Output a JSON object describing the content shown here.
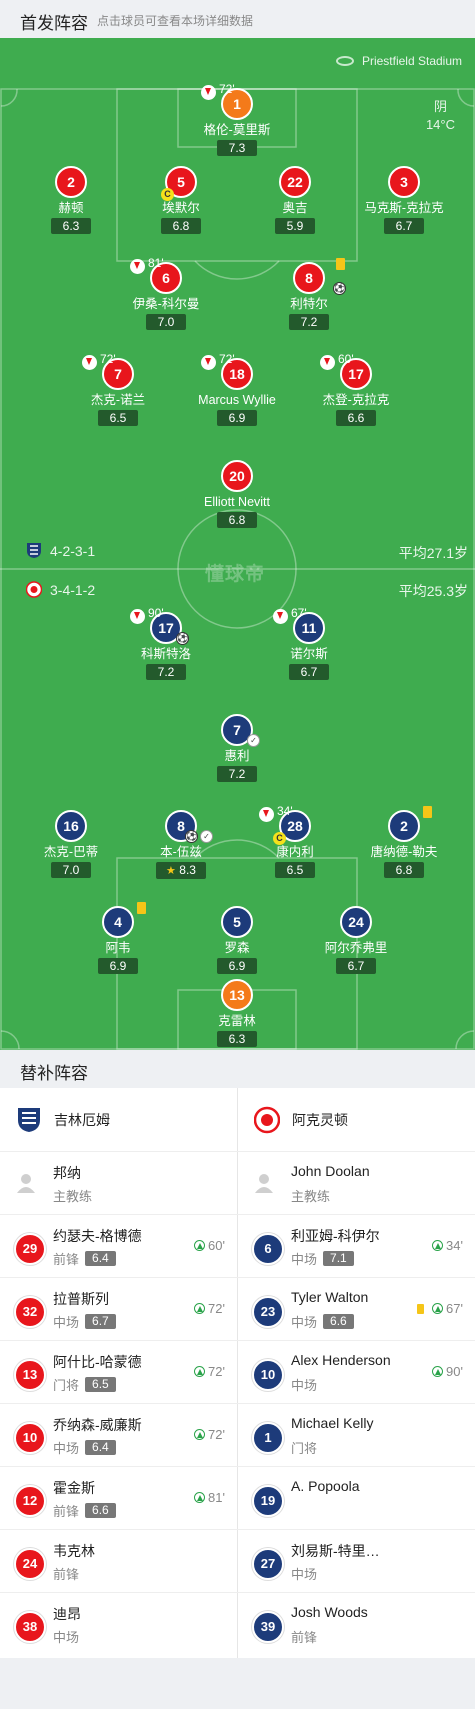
{
  "header": {
    "title": "首发阵容",
    "subtitle": "点击球员可查看本场详细数据"
  },
  "pitch": {
    "stadium": "Priestfield Stadium",
    "weather": {
      "condition": "阴",
      "temp": "14°C"
    },
    "watermark": "懂球帝",
    "home": {
      "formation": "4-2-3-1",
      "avg_age": "平均27.1岁"
    },
    "away": {
      "formation": "3-4-1-2",
      "avg_age": "平均25.3岁"
    }
  },
  "home_players": [
    {
      "num": "1",
      "name": "格伦-莫里斯",
      "rating": "7.3",
      "sub_min": "72'"
    },
    {
      "num": "2",
      "name": "赫顿",
      "rating": "6.3"
    },
    {
      "num": "5",
      "name": "埃默尔",
      "rating": "6.8"
    },
    {
      "num": "22",
      "name": "奥吉",
      "rating": "5.9"
    },
    {
      "num": "3",
      "name": "马克斯-克拉克",
      "rating": "6.7"
    },
    {
      "num": "6",
      "name": "伊桑-科尔曼",
      "rating": "7.0",
      "sub_min": "81'"
    },
    {
      "num": "8",
      "name": "利特尔",
      "rating": "7.2"
    },
    {
      "num": "7",
      "name": "杰克-诺兰",
      "rating": "6.5",
      "sub_min": "72'"
    },
    {
      "num": "18",
      "name": "Marcus Wyllie",
      "rating": "6.9",
      "sub_min": "72'"
    },
    {
      "num": "17",
      "name": "杰登-克拉克",
      "rating": "6.6",
      "sub_min": "60'"
    },
    {
      "num": "20",
      "name": "Elliott Nevitt",
      "rating": "6.8"
    }
  ],
  "away_players": [
    {
      "num": "17",
      "name": "科斯特洛",
      "rating": "7.2",
      "sub_min": "90'"
    },
    {
      "num": "11",
      "name": "诺尔斯",
      "rating": "6.7",
      "sub_min": "67'"
    },
    {
      "num": "7",
      "name": "惠利",
      "rating": "7.2"
    },
    {
      "num": "16",
      "name": "杰克-巴蒂",
      "rating": "7.0"
    },
    {
      "num": "8",
      "name": "本-伍兹",
      "rating": "8.3"
    },
    {
      "num": "28",
      "name": "康内利",
      "rating": "6.5",
      "sub_min": "34'"
    },
    {
      "num": "2",
      "name": "唐纳德-勒夫",
      "rating": "6.8"
    },
    {
      "num": "4",
      "name": "阿韦",
      "rating": "6.9"
    },
    {
      "num": "5",
      "name": "罗森",
      "rating": "6.9"
    },
    {
      "num": "24",
      "name": "阿尔乔弗里",
      "rating": "6.7"
    },
    {
      "num": "13",
      "name": "克雷林",
      "rating": "6.3"
    }
  ],
  "subs_header": {
    "title": "替补阵容"
  },
  "subs": {
    "home_team": "吉林厄姆",
    "away_team": "阿克灵顿",
    "home_coach": {
      "name": "邦纳",
      "role": "主教练"
    },
    "away_coach": {
      "name": "John Doolan",
      "role": "主教练"
    },
    "home": [
      {
        "num": "29",
        "name": "约瑟夫-格博德",
        "pos": "前锋",
        "rating": "6.4",
        "in": "60'"
      },
      {
        "num": "32",
        "name": "拉普斯列",
        "pos": "中场",
        "rating": "6.7",
        "in": "72'"
      },
      {
        "num": "13",
        "name": "阿什比-哈蒙德",
        "pos": "门将",
        "rating": "6.5",
        "in": "72'"
      },
      {
        "num": "10",
        "name": "乔纳森-威廉斯",
        "pos": "中场",
        "rating": "6.4",
        "in": "72'"
      },
      {
        "num": "12",
        "name": "霍金斯",
        "pos": "前锋",
        "rating": "6.6",
        "in": "81'"
      },
      {
        "num": "24",
        "name": "韦克林",
        "pos": "前锋"
      },
      {
        "num": "38",
        "name": "迪昂",
        "pos": "中场"
      }
    ],
    "away": [
      {
        "num": "6",
        "name": "利亚姆-科伊尔",
        "pos": "中场",
        "rating": "7.1",
        "in": "34'"
      },
      {
        "num": "23",
        "name": "Tyler Walton",
        "pos": "中场",
        "rating": "6.6",
        "in": "67'"
      },
      {
        "num": "10",
        "name": "Alex Henderson",
        "pos": "中场",
        "in": "90'"
      },
      {
        "num": "1",
        "name": "Michael Kelly",
        "pos": "门将"
      },
      {
        "num": "19",
        "name": "A. Popoola",
        "pos": ""
      },
      {
        "num": "27",
        "name": "刘易斯-特里…",
        "pos": "中场"
      },
      {
        "num": "39",
        "name": "Josh Woods",
        "pos": "前锋"
      }
    ]
  }
}
